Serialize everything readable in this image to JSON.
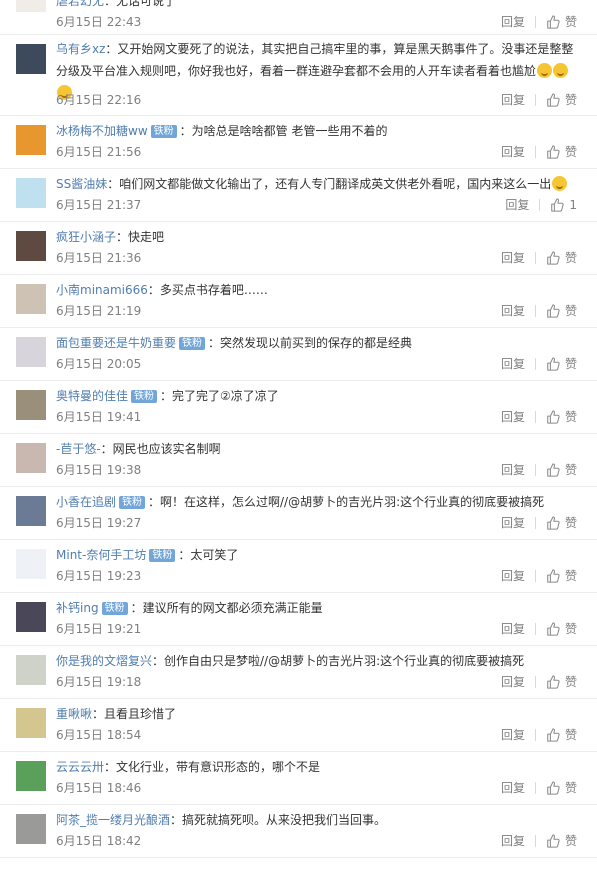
{
  "comments": [
    {
      "user": "虐若幻无",
      "badge": "",
      "text": "：无话可说了",
      "time": "6月15日 22:43",
      "reply": "回复",
      "like": "赞",
      "avatar_color": "#f0ede8"
    },
    {
      "user": "乌有乡xz",
      "badge": "",
      "text": "：又开始网文要死了的说法，其实把自己搞牢里的事，算是黑天鹅事件了。没事还是整整分级及平台准入规则吧，你好我也好，看着一群连避孕套都不会用的人开车读者看着也尴尬",
      "time": "6月15日 22:16",
      "reply": "回复",
      "like": "赞",
      "avatar_color": "#3d4a5c"
    },
    {
      "user": "冰杨梅不加糖ww",
      "badge": "铁粉",
      "text": "：为啥总是啥啥都管 老管一些用不着的",
      "time": "6月15日 21:56",
      "reply": "回复",
      "like": "赞",
      "avatar_color": "#e8962e"
    },
    {
      "user": "SS酱油妹",
      "badge": "",
      "text": "：咱们网文都能做文化输出了，还有人专门翻译成英文供老外看呢，国内来这么一出",
      "time": "6月15日 21:37",
      "reply": "回复",
      "like": "1",
      "avatar_color": "#bfe0ee"
    },
    {
      "user": "疯狂小涵子",
      "badge": "",
      "text": "：快走吧",
      "time": "6月15日 21:36",
      "reply": "回复",
      "like": "赞",
      "avatar_color": "#5e4a40"
    },
    {
      "user": "小南minami666",
      "badge": "",
      "text": "：多买点书存着吧……",
      "time": "6月15日 21:19",
      "reply": "回复",
      "like": "赞",
      "avatar_color": "#cdc2b4"
    },
    {
      "user": "面包重要还是牛奶重要",
      "badge": "铁粉",
      "text": "：突然发现以前买到的保存的都是经典",
      "time": "6月15日 20:05",
      "reply": "回复",
      "like": "赞",
      "avatar_color": "#d8d4dc"
    },
    {
      "user": "奥特曼的佳佳",
      "badge": "铁粉",
      "text": "：完了完了②凉了凉了",
      "time": "6月15日 19:41",
      "reply": "回复",
      "like": "赞",
      "avatar_color": "#9a8f7a"
    },
    {
      "user": "-苣于悠-",
      "badge": "",
      "text": "：网民也应该实名制啊",
      "time": "6月15日 19:38",
      "reply": "回复",
      "like": "赞",
      "avatar_color": "#c9b8b0"
    },
    {
      "user": "小香在追剧",
      "badge": "铁粉",
      "text": "：啊！在这样，怎么过啊//@胡萝卜的吉光片羽:这个行业真的彻底要被搞死",
      "time": "6月15日 19:27",
      "reply": "回复",
      "like": "赞",
      "avatar_color": "#6b7a95"
    },
    {
      "user": "Mint-奈何手工坊",
      "badge": "铁粉",
      "text": "：太可笑了",
      "time": "6月15日 19:23",
      "reply": "回复",
      "like": "赞",
      "avatar_color": "#eef1f6"
    },
    {
      "user": "补钙ing",
      "badge": "铁粉",
      "text": "：建议所有的网文都必须充满正能量",
      "time": "6月15日 19:21",
      "reply": "回复",
      "like": "赞",
      "avatar_color": "#4a4858"
    },
    {
      "user": "你是我的文熠复兴",
      "badge": "",
      "text": "：创作自由只是梦啦//@胡萝卜的吉光片羽:这个行业真的彻底要被搞死",
      "time": "6月15日 19:18",
      "reply": "回复",
      "like": "赞",
      "avatar_color": "#cfd2c8"
    },
    {
      "user": "重啾啾",
      "badge": "",
      "text": "：且看且珍惜了",
      "time": "6月15日 18:54",
      "reply": "回复",
      "like": "赞",
      "avatar_color": "#d3c78f"
    },
    {
      "user": "云云云卅",
      "badge": "",
      "text": "：文化行业，带有意识形态的，哪个不是",
      "time": "6月15日 18:46",
      "reply": "回复",
      "like": "赞",
      "avatar_color": "#5aa05a"
    },
    {
      "user": "阿茶_揽一缕月光酿酒",
      "badge": "",
      "text": "：搞死就搞死呗。从来没把我们当回事。",
      "time": "6月15日 18:42",
      "reply": "回复",
      "like": "赞",
      "avatar_color": "#9a9a98"
    }
  ]
}
